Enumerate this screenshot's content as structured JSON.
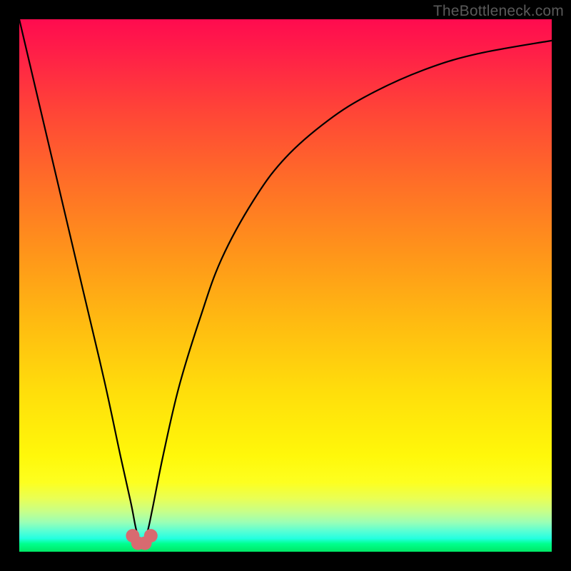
{
  "watermark": {
    "text": "TheBottleneck.com"
  },
  "colors": {
    "frame": "#000000",
    "curve_stroke": "#000000",
    "marker_fill": "#d86a70",
    "marker_stroke": "#b84f55"
  },
  "chart_data": {
    "type": "line",
    "title": "",
    "xlabel": "",
    "ylabel": "",
    "xlim": [
      0,
      100
    ],
    "ylim": [
      0,
      100
    ],
    "grid": false,
    "legend": false,
    "notch_x": 23,
    "series": [
      {
        "name": "bottleneck-curve",
        "x": [
          0,
          4,
          8,
          12,
          16,
          19,
          21,
          22,
          23,
          24,
          25,
          27,
          30,
          34,
          38,
          44,
          50,
          58,
          66,
          76,
          86,
          100
        ],
        "y": [
          100,
          83,
          66,
          49,
          32,
          18,
          9,
          4,
          1.5,
          3.5,
          8,
          18,
          31,
          44,
          55,
          66,
          74,
          81,
          86,
          90.5,
          93.5,
          96
        ]
      }
    ],
    "markers": [
      {
        "x": 21.3,
        "y": 3.0
      },
      {
        "x": 22.3,
        "y": 1.6
      },
      {
        "x": 23.6,
        "y": 1.6
      },
      {
        "x": 24.7,
        "y": 3.0
      }
    ]
  }
}
